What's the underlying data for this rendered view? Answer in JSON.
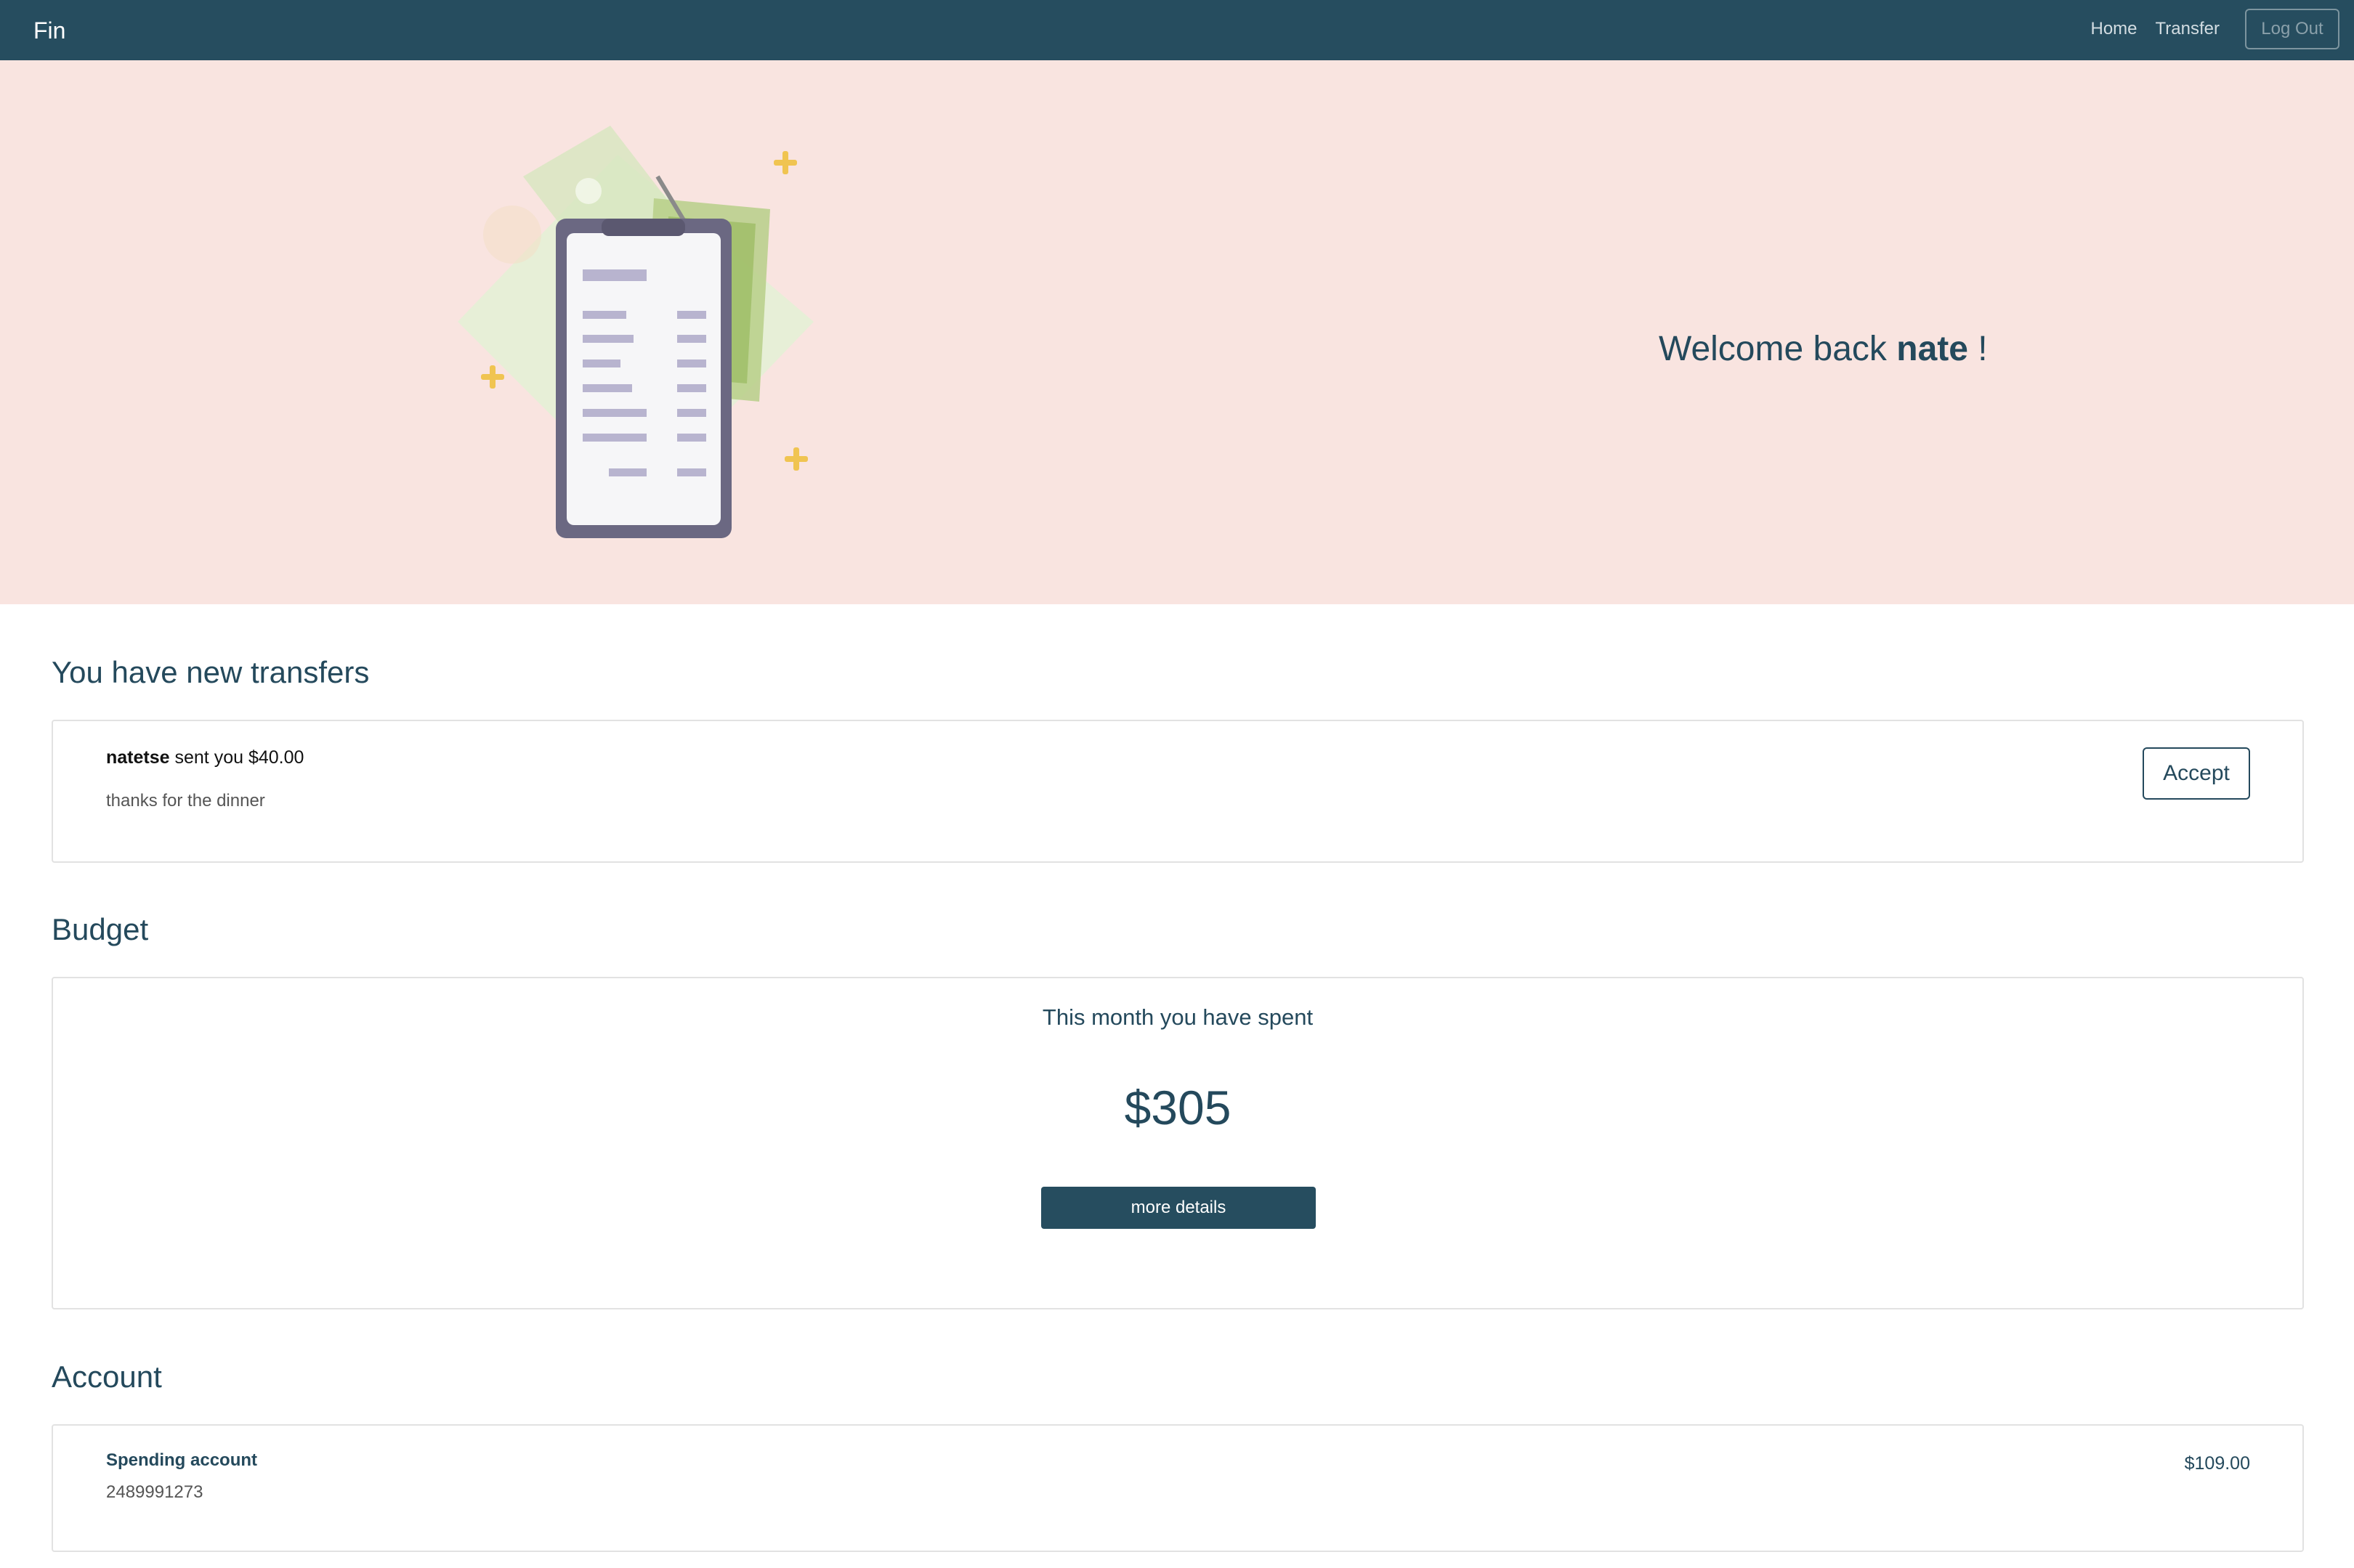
{
  "navbar": {
    "brand": "Fin",
    "links": [
      "Home",
      "Transfer"
    ],
    "logout_label": "Log Out",
    "color": "#264d5f"
  },
  "hero": {
    "background": "#f9e4e0",
    "welcome_prefix": "Welcome back",
    "username": "nate",
    "welcome_suffix": "!",
    "illustration": "phone-receipt-money-icon"
  },
  "transfers": {
    "title": "You have new transfers",
    "items": [
      {
        "sender": "natetse",
        "text": "sent you $40.00",
        "note": "thanks for the dinner",
        "action_label": "Accept"
      }
    ]
  },
  "budget": {
    "title": "Budget",
    "heading": "This month you have spent",
    "amount": "$305",
    "button_label": "more details"
  },
  "account": {
    "title": "Account",
    "items": [
      {
        "name": "Spending account",
        "number": "2489991273",
        "balance": "$109.00"
      }
    ]
  }
}
